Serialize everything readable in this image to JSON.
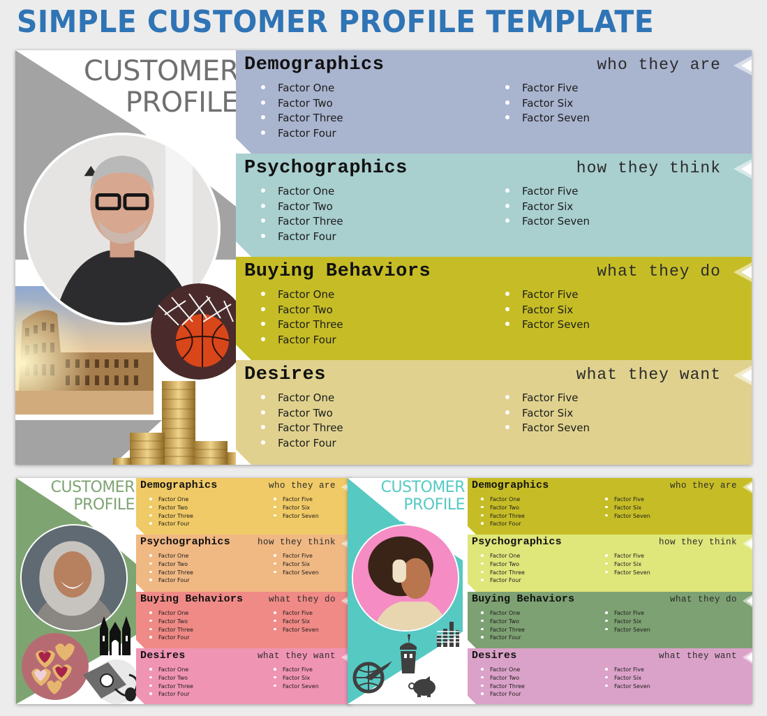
{
  "page_title": "SIMPLE CUSTOMER PROFILE TEMPLATE",
  "cards": [
    {
      "id": "gray",
      "heading_line1": "CUSTOMER",
      "heading_line2": "PROFILE",
      "accent": "#a3a3a3",
      "heading_color": "#707070",
      "images": [
        "man-portrait",
        "colosseum",
        "basketball",
        "coin-stacks"
      ],
      "panels": [
        {
          "title": "Demographics",
          "tag": "who they are",
          "color": "#a9b4cf",
          "col1": [
            "Factor One",
            "Factor Two",
            "Factor Three",
            "Factor Four"
          ],
          "col2": [
            "Factor Five",
            "Factor Six",
            "Factor Seven"
          ]
        },
        {
          "title": "Psychographics",
          "tag": "how they think",
          "color": "#a9cfcf",
          "col1": [
            "Factor One",
            "Factor Two",
            "Factor Three",
            "Factor Four"
          ],
          "col2": [
            "Factor Five",
            "Factor Six",
            "Factor Seven"
          ]
        },
        {
          "title": "Buying Behaviors",
          "tag": "what they do",
          "color": "#c6bd26",
          "col1": [
            "Factor One",
            "Factor Two",
            "Factor Three",
            "Factor Four"
          ],
          "col2": [
            "Factor Five",
            "Factor Six",
            "Factor Seven"
          ]
        },
        {
          "title": "Desires",
          "tag": "what they want",
          "color": "#e0d28e",
          "col1": [
            "Factor One",
            "Factor Two",
            "Factor Three",
            "Factor Four"
          ],
          "col2": [
            "Factor Five",
            "Factor Six",
            "Factor Seven"
          ]
        }
      ]
    },
    {
      "id": "green",
      "heading_line1": "CUSTOMER",
      "heading_line2": "PROFILE",
      "accent": "#7ea472",
      "heading_color": "#7ea472",
      "images": [
        "woman-portrait",
        "cathedral-icon",
        "heart-cookies",
        "blood-pressure-cuff"
      ],
      "panels": [
        {
          "title": "Demographics",
          "tag": "who they are",
          "color": "#f0ca66",
          "col1": [
            "Factor One",
            "Factor Two",
            "Factor Three",
            "Factor Four"
          ],
          "col2": [
            "Factor Five",
            "Factor Six",
            "Factor Seven"
          ]
        },
        {
          "title": "Psychographics",
          "tag": "how they think",
          "color": "#f0b883",
          "col1": [
            "Factor One",
            "Factor Two",
            "Factor Three",
            "Factor Four"
          ],
          "col2": [
            "Factor Five",
            "Factor Six",
            "Factor Seven"
          ]
        },
        {
          "title": "Buying Behaviors",
          "tag": "what they do",
          "color": "#f08a86",
          "col1": [
            "Factor One",
            "Factor Two",
            "Factor Three",
            "Factor Four"
          ],
          "col2": [
            "Factor Five",
            "Factor Six",
            "Factor Seven"
          ]
        },
        {
          "title": "Desires",
          "tag": "what they want",
          "color": "#f094b4",
          "col1": [
            "Factor One",
            "Factor Two",
            "Factor Three",
            "Factor Four"
          ],
          "col2": [
            "Factor Five",
            "Factor Six",
            "Factor Seven"
          ]
        }
      ]
    },
    {
      "id": "teal",
      "heading_line1": "CUSTOMER",
      "heading_line2": "PROFILE",
      "accent": "#56c9c3",
      "heading_color": "#56c9c3",
      "images": [
        "headphones-woman-portrait",
        "equalizer-icon",
        "drink-cup-icon",
        "travel-globe-plane-icon",
        "piggy-bank-icon"
      ],
      "panels": [
        {
          "title": "Demographics",
          "tag": "who they are",
          "color": "#c6bd26",
          "col1": [
            "Factor One",
            "Factor Two",
            "Factor Three",
            "Factor Four"
          ],
          "col2": [
            "Factor Five",
            "Factor Six",
            "Factor Seven"
          ]
        },
        {
          "title": "Psychographics",
          "tag": "how they think",
          "color": "#dfe67a",
          "col1": [
            "Factor One",
            "Factor Two",
            "Factor Three",
            "Factor Four"
          ],
          "col2": [
            "Factor Five",
            "Factor Six",
            "Factor Seven"
          ]
        },
        {
          "title": "Buying Behaviors",
          "tag": "what they do",
          "color": "#7da172",
          "col1": [
            "Factor One",
            "Factor Two",
            "Factor Three",
            "Factor Four"
          ],
          "col2": [
            "Factor Five",
            "Factor Six",
            "Factor Seven"
          ]
        },
        {
          "title": "Desires",
          "tag": "what they want",
          "color": "#dba2c9",
          "col1": [
            "Factor One",
            "Factor Two",
            "Factor Three",
            "Factor Four"
          ],
          "col2": [
            "Factor Five",
            "Factor Six",
            "Factor Seven"
          ]
        }
      ]
    }
  ]
}
